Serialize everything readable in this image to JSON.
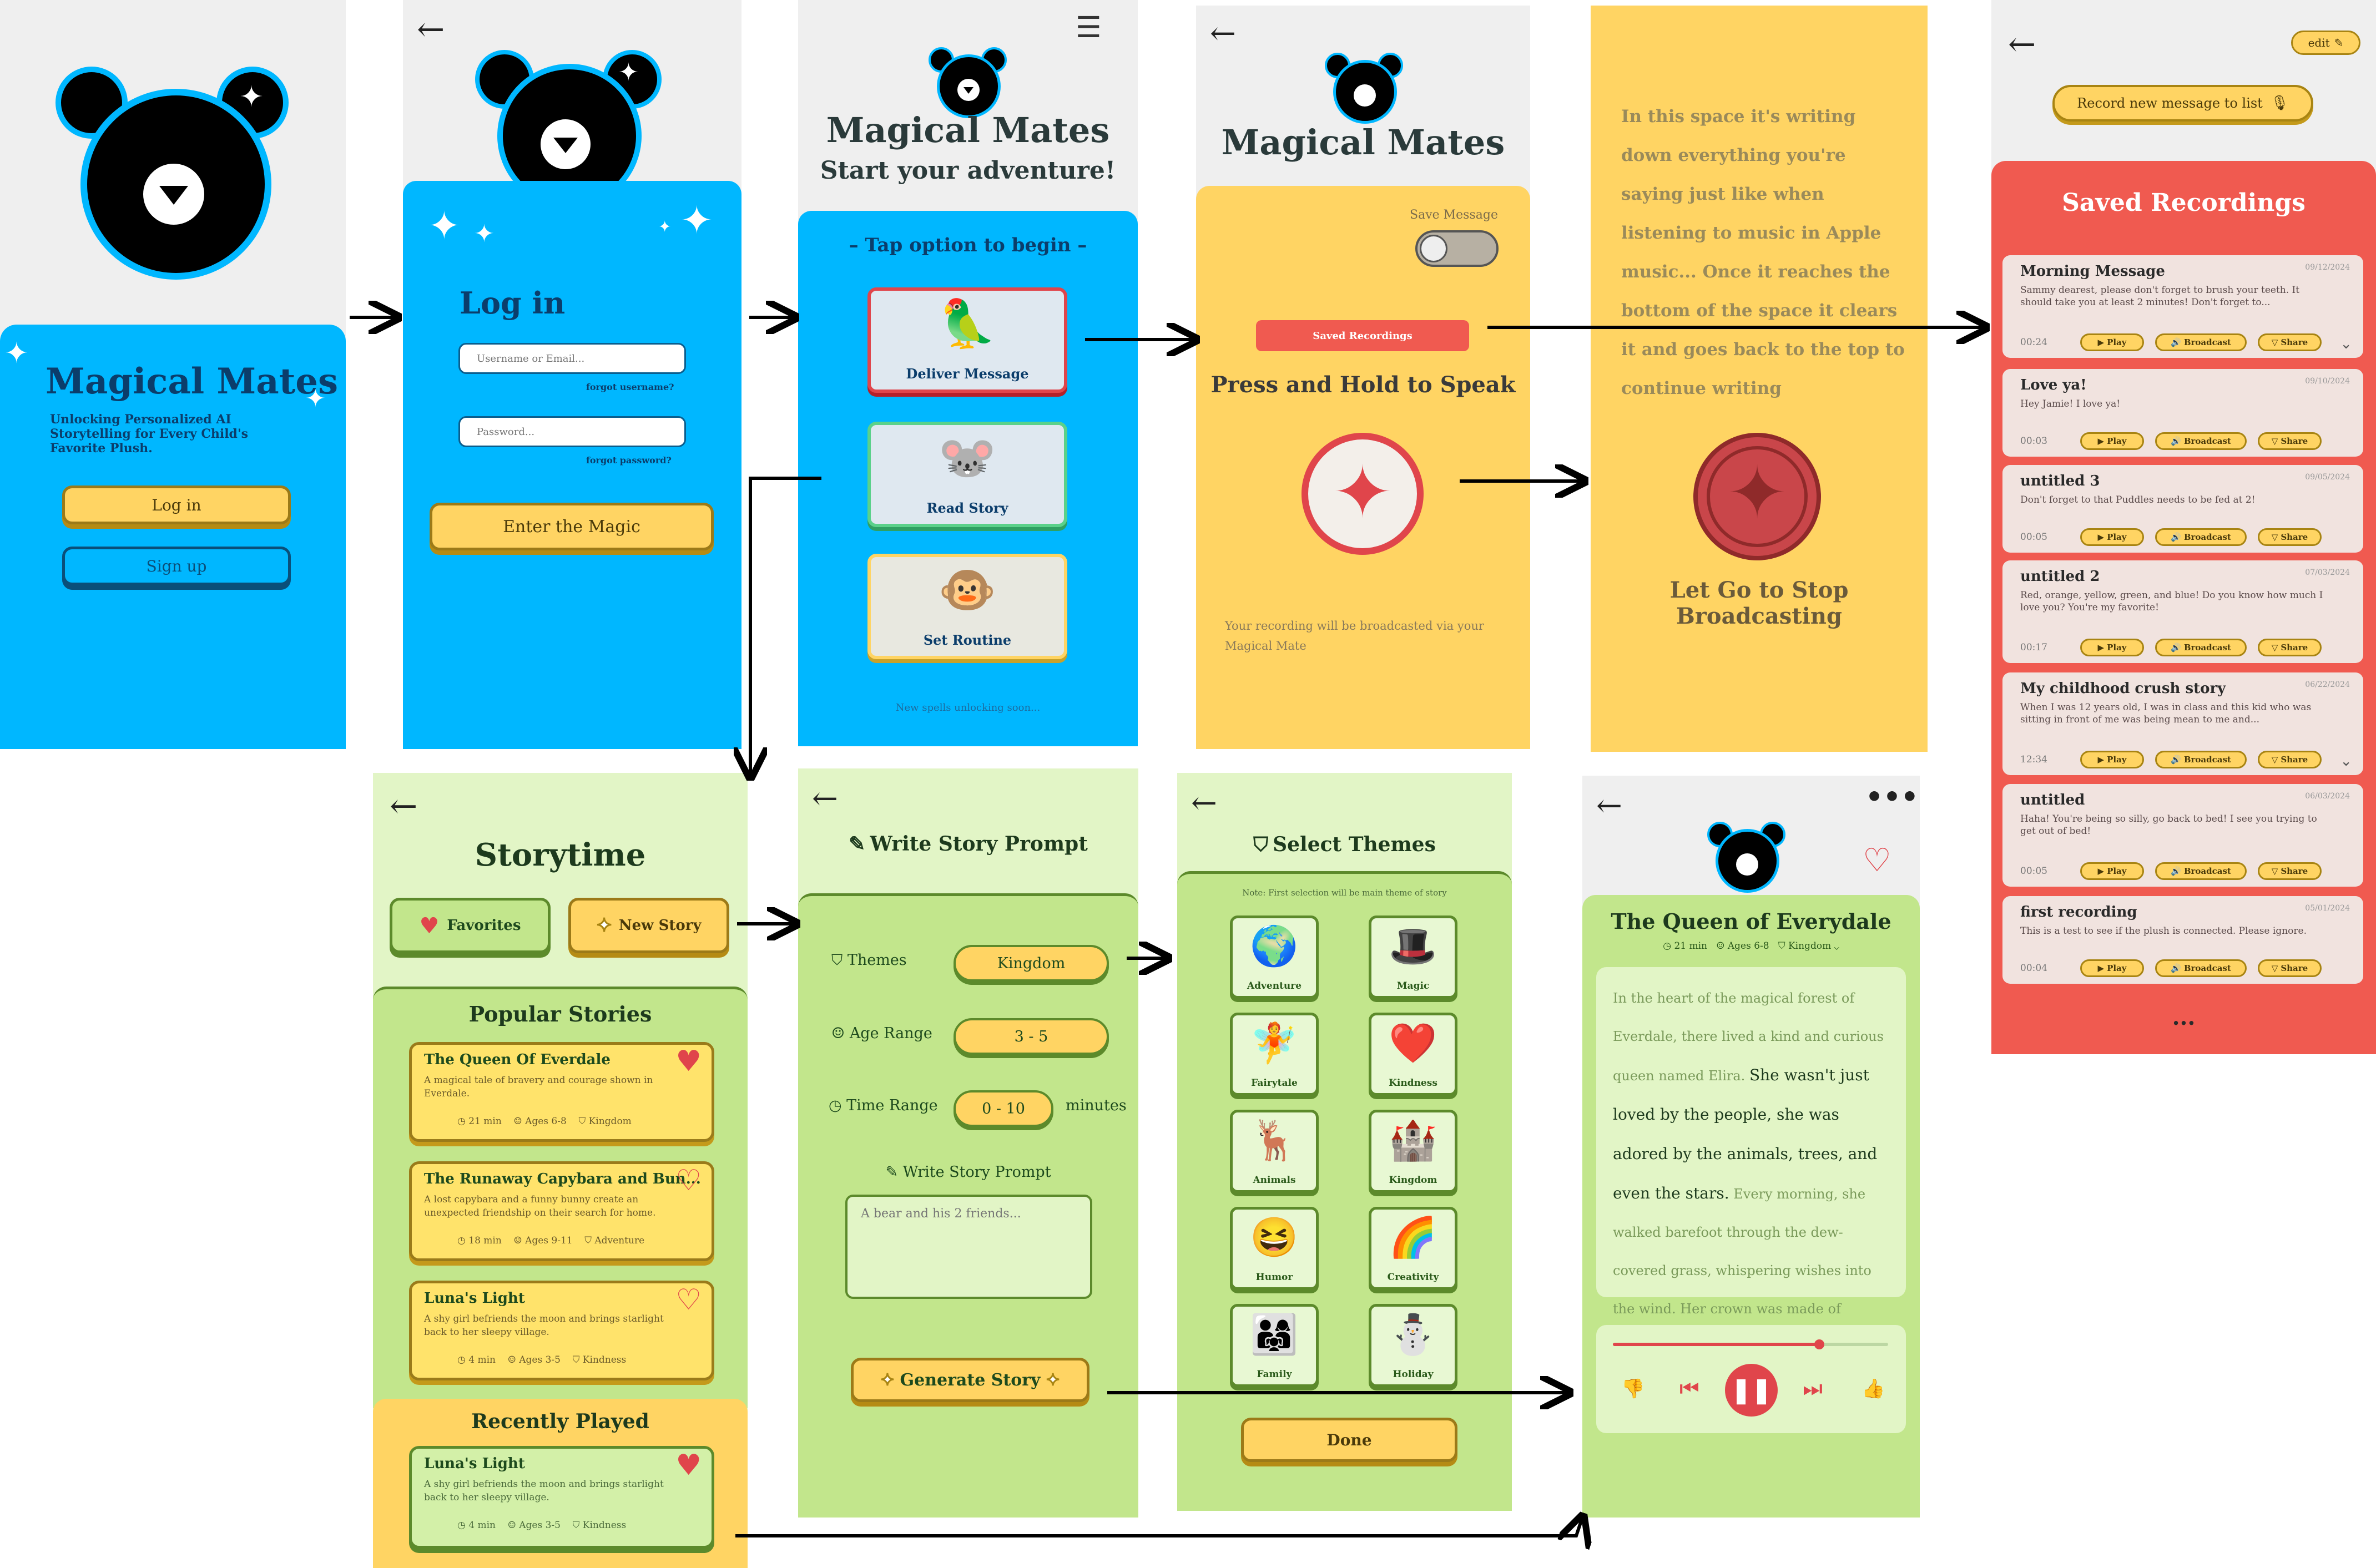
{
  "colors": {
    "blue": "#00b7ff",
    "yellow": "#ffd463",
    "red": "#f05a50",
    "green_light": "#e2f5c6",
    "green": "#c2e68c",
    "grey": "#efefef"
  },
  "s1": {
    "title": "Magical Mates",
    "tagline": "Unlocking Personalized AI Storytelling for Every Child's Favorite Plush.",
    "login": "Log in",
    "signup": "Sign up"
  },
  "s2": {
    "title": "Log in",
    "username_ph": "Username or Email...",
    "forgot_user": "forgot username?",
    "password_ph": "Password...",
    "forgot_pass": "forgot password?",
    "enter": "Enter the Magic"
  },
  "s3": {
    "title": "Magical Mates",
    "subtitle": "Start your adventure!",
    "tap": "– Tap option to begin –",
    "opt1": "Deliver Message",
    "opt2": "Read Story",
    "opt3": "Set Routine",
    "footer": "New spells unlocking soon..."
  },
  "s4": {
    "title": "Magical Mates",
    "save": "Save Message",
    "saved": "Saved Recordings",
    "press": "Press and Hold to Speak",
    "note": "Your recording will be broadcasted via your Magical Mate"
  },
  "s5": {
    "text": "In this space it's writing down everything you're saying just like when listening to music in Apple music... Once it reaches the bottom of the space it clears it and goes back to the top to continue writing",
    "letgo": "Let Go to Stop Broadcasting"
  },
  "s6": {
    "edit": "edit",
    "record": "Record new message to list",
    "header": "Saved Recordings",
    "play": "Play",
    "broadcast": "Broadcast",
    "share": "Share",
    "more": "...",
    "items": [
      {
        "title": "Morning Message",
        "date": "09/12/2024",
        "body": "Sammy dearest, please don't forget to brush your teeth. It should take you at least 2 minutes! Don't forget to...",
        "dur": "00:24"
      },
      {
        "title": "Love ya!",
        "date": "09/10/2024",
        "body": "Hey Jamie! I love ya!",
        "dur": "00:03"
      },
      {
        "title": "untitled 3",
        "date": "09/05/2024",
        "body": "Don't forget to that Puddles needs to be fed at 2!",
        "dur": "00:05"
      },
      {
        "title": "untitled 2",
        "date": "07/03/2024",
        "body": "Red, orange, yellow, green, and blue! Do you know how much I love you? You're my favorite!",
        "dur": "00:17"
      },
      {
        "title": "My childhood crush story",
        "date": "06/22/2024",
        "body": "When I was 12 years old, I was in class and this kid who was sitting in front of me was being mean to me and...",
        "dur": "12:34"
      },
      {
        "title": "untitled",
        "date": "06/03/2024",
        "body": "Haha! You're being so silly, go back to bed! I see you trying to get out of bed!",
        "dur": "00:05"
      },
      {
        "title": "first recording",
        "date": "05/01/2024",
        "body": "This is a test to see if the plush is connected. Please ignore.",
        "dur": "00:04"
      }
    ]
  },
  "s7": {
    "title": "Storytime",
    "favorites": "Favorites",
    "newstory": "New Story",
    "popular": "Popular Stories",
    "recent": "Recently Played",
    "stories": [
      {
        "title": "The Queen Of Everdale",
        "desc": "A magical tale of bravery and courage shown in Everdale.",
        "time": "21 min",
        "ages": "Ages 6-8",
        "theme": "Kingdom"
      },
      {
        "title": "The Runaway Capybara and Bun...",
        "desc": "A lost capybara and a funny bunny create an unexpected friendship on their search for home.",
        "time": "18 min",
        "ages": "Ages 9-11",
        "theme": "Adventure"
      },
      {
        "title": "Luna's Light",
        "desc": "A shy girl befriends the moon and brings starlight back to her sleepy village.",
        "time": "4 min",
        "ages": "Ages 3-5",
        "theme": "Kindness"
      }
    ],
    "recent_story": {
      "title": "Luna's Light",
      "desc": "A shy girl befriends the moon and brings starlight back to her sleepy village.",
      "time": "4 min",
      "ages": "Ages 3-5",
      "theme": "Kindness"
    }
  },
  "s8": {
    "title": "Write Story Prompt",
    "themes": "Themes",
    "themes_val": "Kingdom",
    "age": "Age Range",
    "age_val": "3 - 5",
    "time": "Time Range",
    "time_val": "0 - 10",
    "minutes": "minutes",
    "prompt": "Write Story Prompt",
    "prompt_ph": "A bear and his 2 friends...",
    "generate": "Generate Story"
  },
  "s9": {
    "title": "Select Themes",
    "note": "Note: First selection will be main theme of story",
    "done": "Done",
    "themes": [
      "Adventure",
      "Magic",
      "Fairytale",
      "Kindness",
      "Animals",
      "Kingdom",
      "Humor",
      "Creativity",
      "Family",
      "Holiday"
    ]
  },
  "s10": {
    "title": "The Queen of Everydale",
    "time": "21 min",
    "ages": "Ages 6-8",
    "theme": "Kingdom",
    "story_a": "In the heart of the magical forest of Everdale, there lived a kind and curious queen named Elira.",
    "story_b": "She wasn't just loved by the people, she was adored by the animals, trees, and even the stars.",
    "story_c": "Every morning, she walked barefoot through the dew-covered grass, whispering wishes into the wind. Her crown was made of golden ...",
    "progress": 0.75
  }
}
